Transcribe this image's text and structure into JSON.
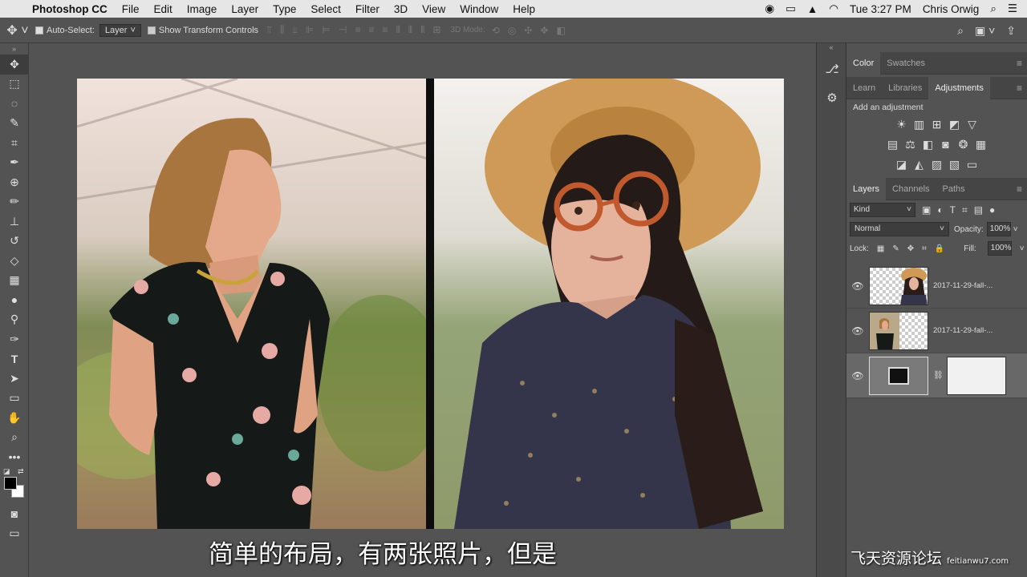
{
  "menubar": {
    "app_name": "Photoshop CC",
    "items": [
      "File",
      "Edit",
      "Image",
      "Layer",
      "Type",
      "Select",
      "Filter",
      "3D",
      "View",
      "Window",
      "Help"
    ],
    "clock": "Tue 3:27 PM",
    "user": "Chris Orwig"
  },
  "options": {
    "auto_select_label": "Auto-Select:",
    "auto_select_value": "Layer",
    "show_transform_label": "Show Transform Controls",
    "mode_3d_label": "3D Mode:"
  },
  "panels": {
    "top_tabs": [
      "Color",
      "Swatches"
    ],
    "mid_tabs": [
      "Learn",
      "Libraries",
      "Adjustments"
    ],
    "add_adjustment": "Add an adjustment",
    "layers_tabs": [
      "Layers",
      "Channels",
      "Paths"
    ],
    "filter_kind": "Kind",
    "blend_mode": "Normal",
    "opacity_label": "Opacity:",
    "opacity_value": "100%",
    "lock_label": "Lock:",
    "fill_label": "Fill:",
    "fill_value": "100%"
  },
  "layers": [
    {
      "name": "2017-11-29-fall-..."
    },
    {
      "name": "2017-11-29-fall-..."
    },
    {
      "name": ""
    }
  ],
  "subtitle": "简单的布局，有两张照片，但是",
  "watermark": {
    "text": "飞天资源论坛",
    "url": "feitianwu7.com"
  },
  "colors": {
    "accent": "#4a90d9",
    "panel_bg": "#535353"
  }
}
